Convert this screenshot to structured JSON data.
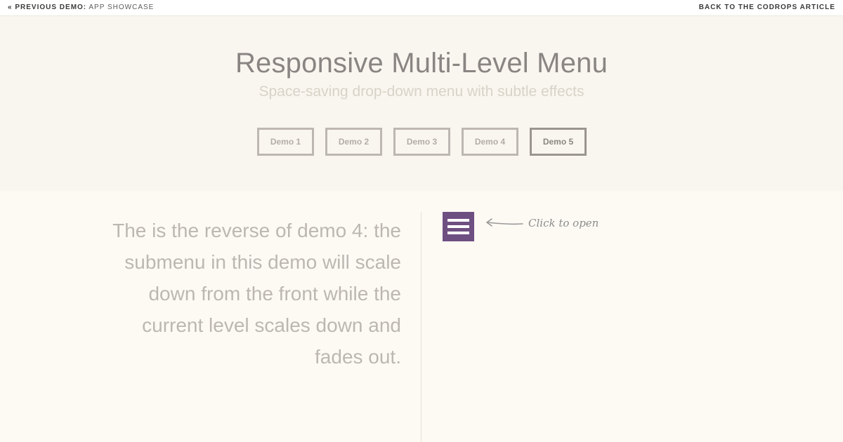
{
  "topbar": {
    "prev_label": "« Previous Demo:",
    "prev_target": "App Showcase",
    "back_label": "Back to the Codrops Article"
  },
  "header": {
    "title": "Responsive Multi-Level Menu",
    "subtitle": "Space-saving drop-down menu with subtle effects"
  },
  "demo_nav": {
    "items": [
      {
        "label": "Demo 1"
      },
      {
        "label": "Demo 2"
      },
      {
        "label": "Demo 3"
      },
      {
        "label": "Demo 4"
      },
      {
        "label": "Demo 5",
        "current": true
      }
    ]
  },
  "content": {
    "description": "The is the reverse of demo 4: the submenu in this demo will scale down from the front while the current level scales down and fades out.",
    "menu_icon": "hamburger-icon",
    "hint": "Click to open"
  },
  "colors": {
    "accent": "#6e4f82",
    "header_bg": "#f9f6ef",
    "page_bg": "#fdfaf4"
  }
}
